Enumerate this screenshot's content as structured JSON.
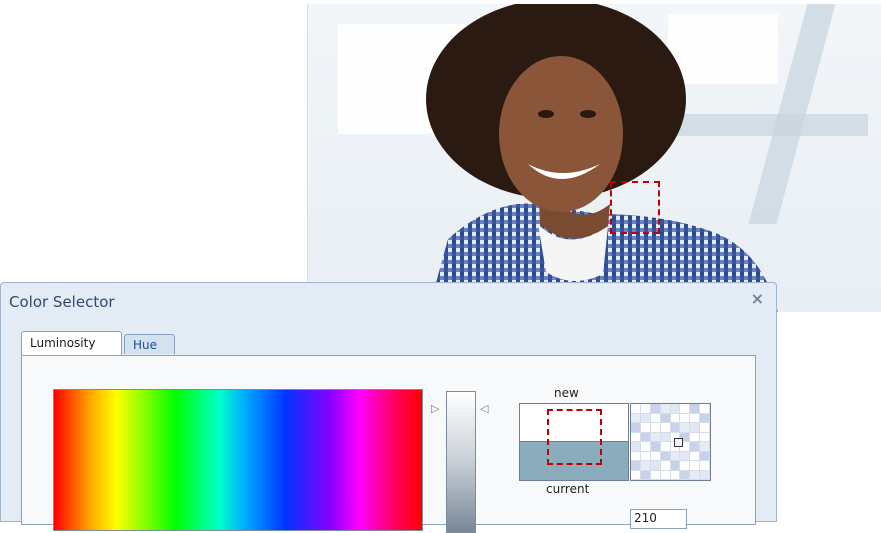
{
  "dialog": {
    "title": "Color Selector",
    "close_glyph": "×",
    "tabs": [
      {
        "label": "Luminosity",
        "active": true
      },
      {
        "label": "Hue",
        "active": false
      }
    ],
    "labels": {
      "new": "new",
      "current": "current"
    },
    "current_color": "#8bacbc",
    "new_color": "#ffffff",
    "marker_color": "#c00000",
    "partial_field_text": "210"
  },
  "icons": {
    "close": "close-icon",
    "luminosity_pointer_left": "triangle-right-icon",
    "luminosity_pointer_right": "triangle-left-icon"
  }
}
